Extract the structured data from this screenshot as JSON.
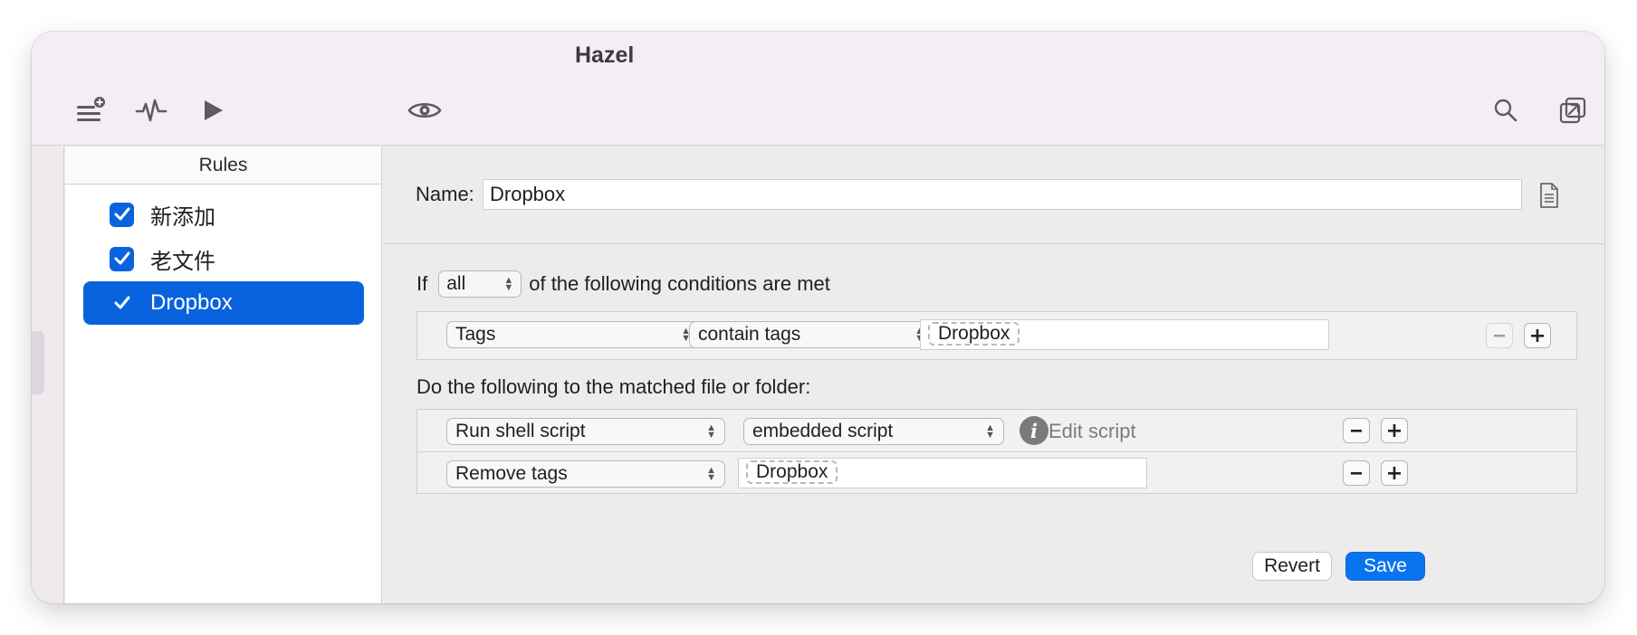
{
  "window": {
    "title": "Hazel"
  },
  "toolbar": {
    "icons": [
      "add-rule-icon",
      "activity-icon",
      "play-icon",
      "preview-eye-icon",
      "search-icon",
      "open-window-icon"
    ]
  },
  "rules": {
    "header": "Rules",
    "items": [
      {
        "label": "新添加",
        "checked": true,
        "selected": false
      },
      {
        "label": "老文件",
        "checked": true,
        "selected": false
      },
      {
        "label": "Dropbox",
        "checked": true,
        "selected": true
      }
    ]
  },
  "editor": {
    "name_label": "Name:",
    "name_value": "Dropbox",
    "conditions": {
      "prefix": "If",
      "match_mode": "all",
      "suffix": "of the following conditions are met",
      "rows": [
        {
          "attribute": "Tags",
          "operator": "contain tags",
          "token": "Dropbox"
        }
      ]
    },
    "actions": {
      "heading": "Do the following to the matched file or folder:",
      "rows": [
        {
          "action": "Run shell script",
          "option": "embedded script",
          "edit_label": "Edit script"
        },
        {
          "action": "Remove tags",
          "token": "Dropbox"
        }
      ]
    },
    "buttons": {
      "revert": "Revert",
      "save": "Save"
    }
  },
  "colors": {
    "accent": "#0a63de",
    "save_button": "#0a74f0",
    "toolbar_bg": "#f4eef4",
    "editor_bg": "#ececec"
  }
}
